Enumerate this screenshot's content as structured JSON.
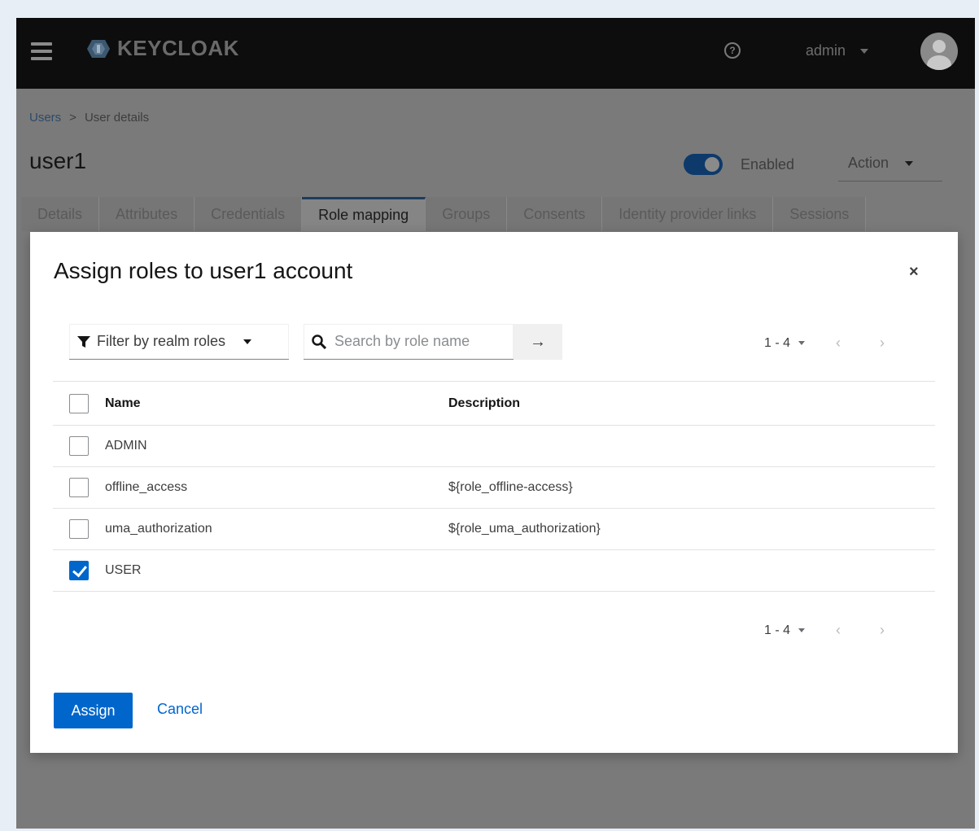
{
  "header": {
    "logo_text": "KEYCLOAK",
    "username": "admin"
  },
  "breadcrumb": {
    "parent": "Users",
    "separator": ">",
    "current": "User details"
  },
  "page": {
    "title": "user1",
    "enabled_label": "Enabled",
    "enabled": true,
    "action_label": "Action"
  },
  "tabs": [
    {
      "label": "Details"
    },
    {
      "label": "Attributes"
    },
    {
      "label": "Credentials"
    },
    {
      "label": "Role mapping",
      "active": true
    },
    {
      "label": "Groups"
    },
    {
      "label": "Consents"
    },
    {
      "label": "Identity provider links"
    },
    {
      "label": "Sessions"
    }
  ],
  "modal": {
    "title": "Assign roles to user1 account",
    "close": "×",
    "filter_label": "Filter by realm roles",
    "search_placeholder": "Search by role name",
    "search_go": "→",
    "pagination": {
      "range": "1 - 4",
      "prev": "‹",
      "next": "›"
    },
    "columns": {
      "name": "Name",
      "description": "Description"
    },
    "rows": [
      {
        "name": "ADMIN",
        "description": "",
        "checked": false
      },
      {
        "name": "offline_access",
        "description": "${role_offline-access}",
        "checked": false
      },
      {
        "name": "uma_authorization",
        "description": "${role_uma_authorization}",
        "checked": false
      },
      {
        "name": "USER",
        "description": "",
        "checked": true
      }
    ],
    "assign_label": "Assign",
    "cancel_label": "Cancel"
  },
  "colors": {
    "primary": "#0066cc",
    "masthead": "#0d0d0d",
    "backdrop": "#7a7a7a"
  }
}
